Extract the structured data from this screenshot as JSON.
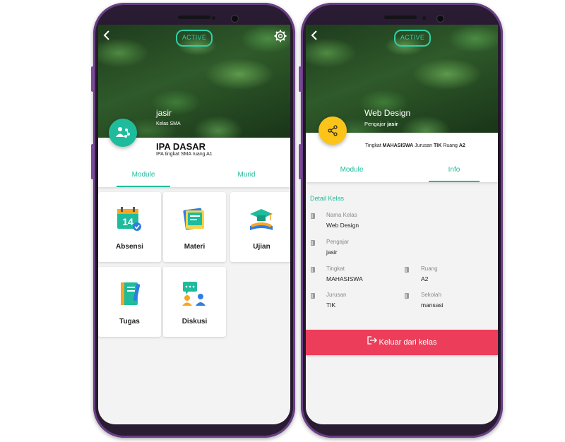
{
  "colors": {
    "accent": "#1ebc9c",
    "badge": "#2ed0a8",
    "danger": "#ec3e5a",
    "share_fab": "#fcc419",
    "phone_frame": "#6a3f86"
  },
  "left_screen": {
    "badge": "ACTIVE",
    "back_icon": "back-arrow-icon",
    "settings_icon": "gear-icon",
    "teacher_name": "jasir",
    "teacher_sub": "Kelas SMA",
    "fab_icon": "people-share-icon",
    "class_title": "IPA DASAR",
    "class_subtitle": "IPA tingkat SMA ruang A1",
    "tabs": [
      "Module",
      "Murid"
    ],
    "modules": [
      {
        "label": "Absensi",
        "icon": "calendar-14-icon"
      },
      {
        "label": "Materi",
        "icon": "book-stack-icon"
      },
      {
        "label": "Ujian",
        "icon": "graduation-cap-icon"
      },
      {
        "label": "Tugas",
        "icon": "notebook-icon"
      },
      {
        "label": "Diskusi",
        "icon": "chat-people-icon"
      }
    ]
  },
  "right_screen": {
    "badge": "ACTIVE",
    "back_icon": "back-arrow-icon",
    "class_title": "Web Design",
    "teacher_prefix": "Pengajar",
    "teacher_name": "jasir",
    "fab_icon": "share-icon",
    "detail_prefix": "Tingkat",
    "detail_level": "MAHASISWA",
    "detail_mid": "Jurusan",
    "detail_major": "TIK",
    "detail_room_prefix": "Ruang",
    "detail_room": "A2",
    "tabs": [
      "Module",
      "Info"
    ],
    "section_title": "Detail Kelas",
    "fields": {
      "nama_kelas": {
        "label": "Nama Kelas",
        "value": "Web Design"
      },
      "pengajar": {
        "label": "Pengajar",
        "value": "jasir"
      },
      "tingkat": {
        "label": "Tingkat",
        "value": "MAHASISWA"
      },
      "ruang": {
        "label": "Ruang",
        "value": "A2"
      },
      "jurusan": {
        "label": "Jurusan",
        "value": "TIK"
      },
      "sekolah": {
        "label": "Sekolah",
        "value": "mansasi"
      }
    },
    "leave_button": "Keluar dari kelas",
    "leave_icon": "logout-icon"
  }
}
